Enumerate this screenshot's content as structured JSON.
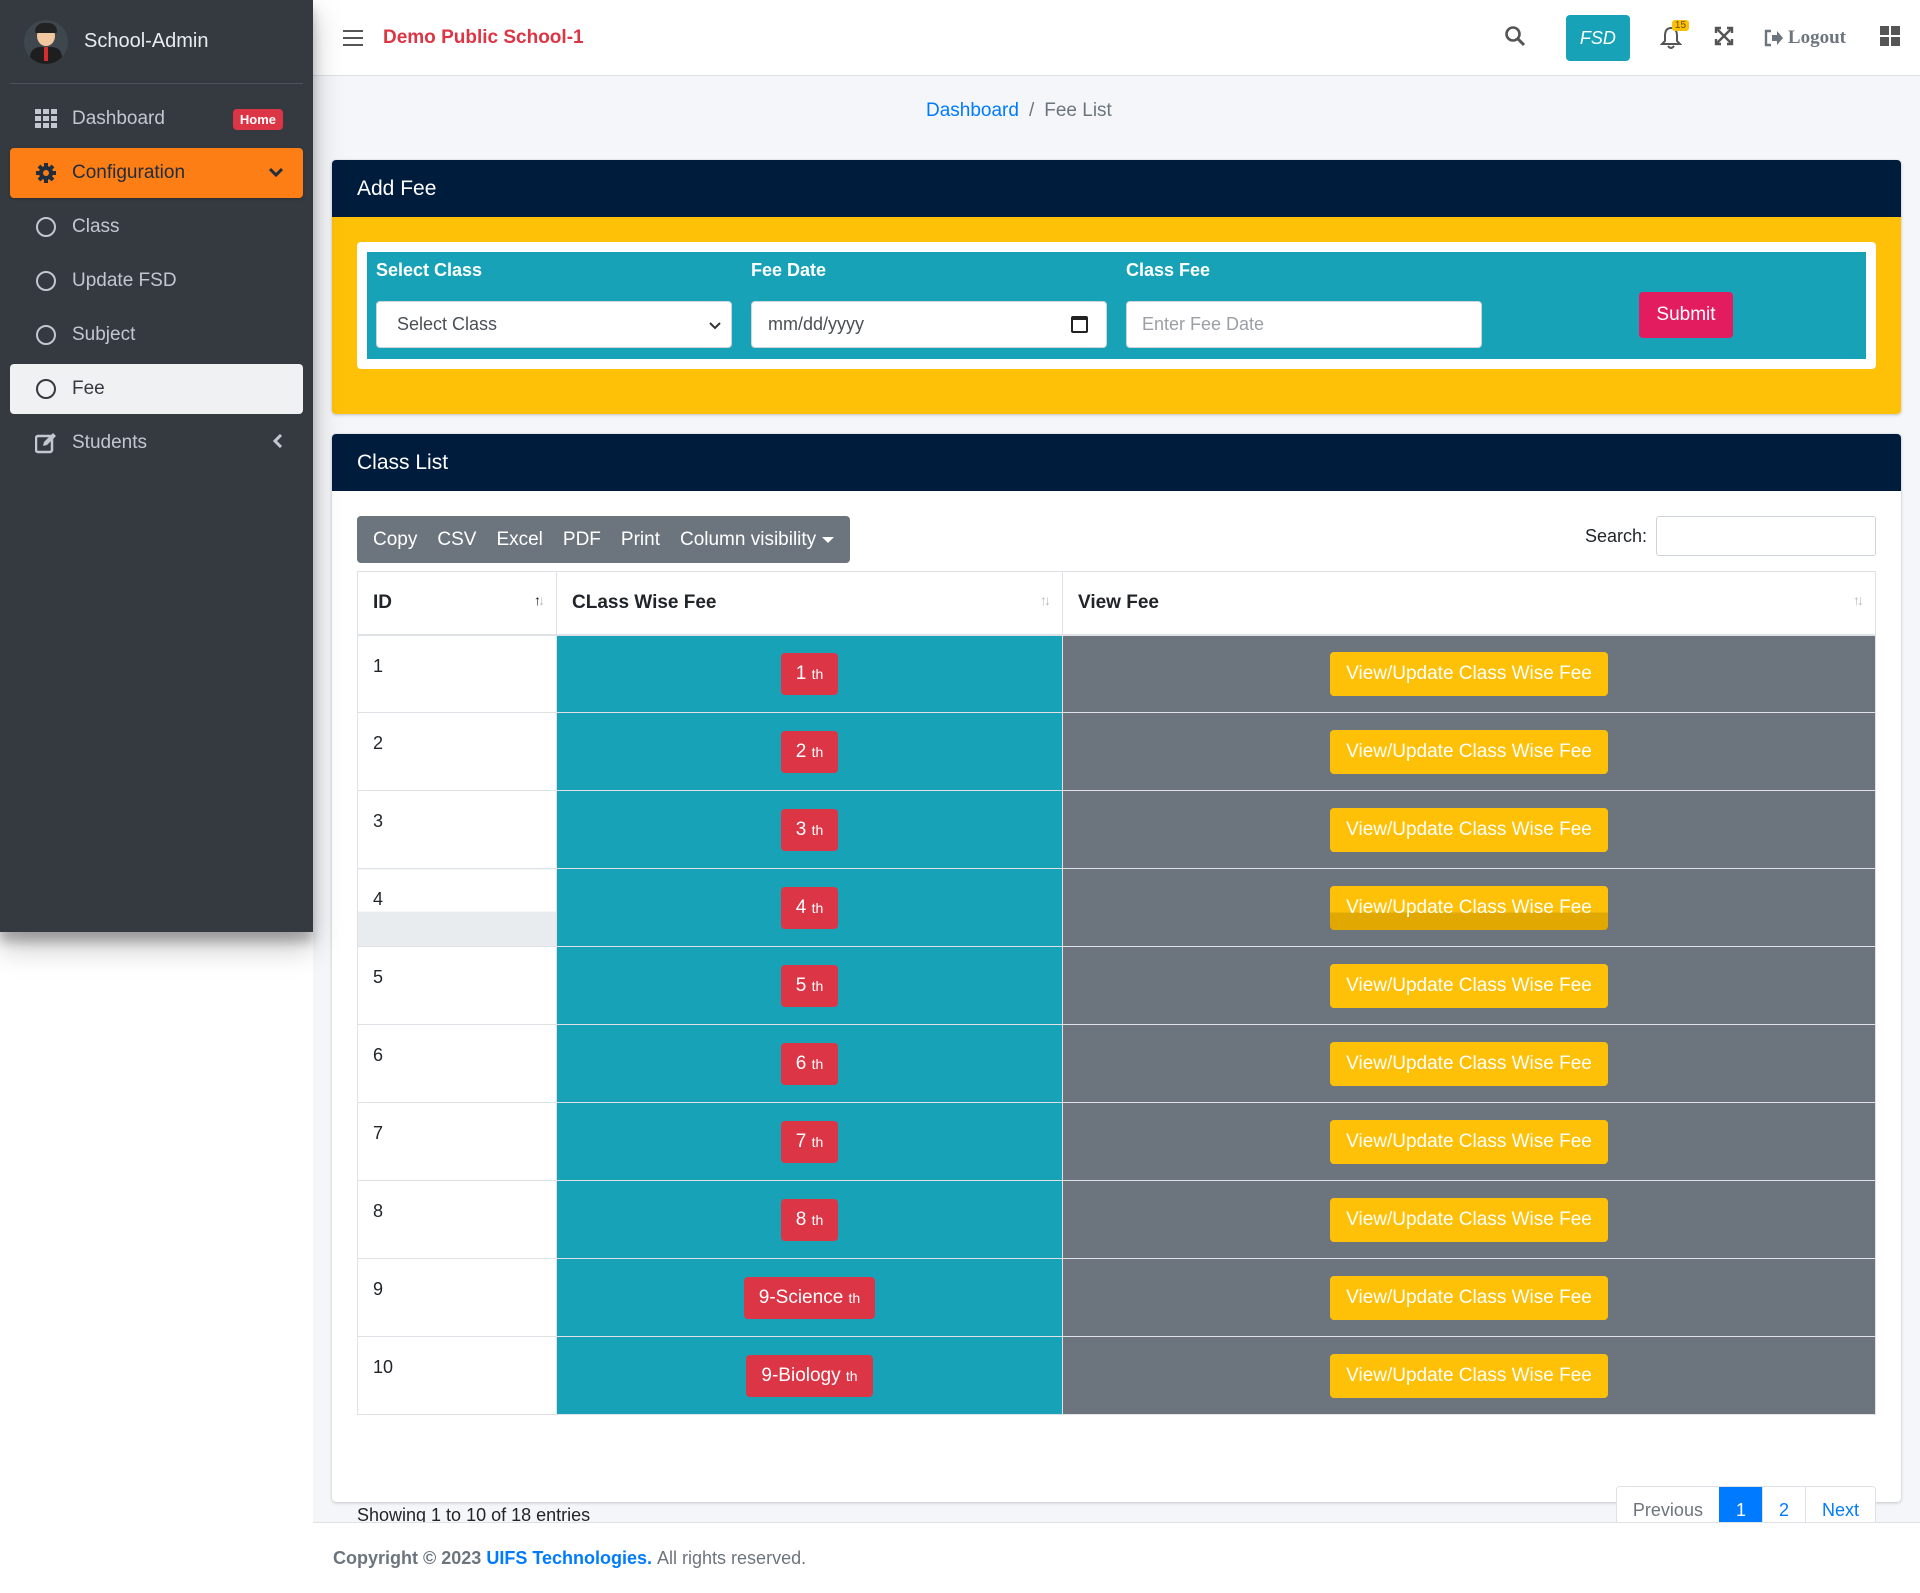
{
  "app": {
    "title": "School-Admin",
    "school_name": "Demo Public School-1"
  },
  "sidebar": {
    "items": [
      {
        "label": "Dashboard",
        "badge": "Home",
        "icon": "grid-icon"
      },
      {
        "label": "Configuration",
        "icon": "gear-icon"
      },
      {
        "label": "Class",
        "icon": "circle-icon"
      },
      {
        "label": "Update FSD",
        "icon": "circle-icon"
      },
      {
        "label": "Subject",
        "icon": "circle-icon"
      },
      {
        "label": "Fee",
        "icon": "circle-icon"
      },
      {
        "label": "Students",
        "icon": "edit-icon"
      }
    ]
  },
  "topbar": {
    "fsd_label": "FSD",
    "notification_count": "15",
    "logout_label": "Logout"
  },
  "breadcrumb": {
    "home": "Dashboard",
    "current": "Fee List"
  },
  "add_fee": {
    "title": "Add Fee",
    "select_class_label": "Select Class",
    "select_class_value": "Select Class",
    "fee_date_label": "Fee Date",
    "fee_date_placeholder": "mm/dd/yyyy",
    "class_fee_label": "Class Fee",
    "class_fee_placeholder": "Enter Fee Date",
    "submit_label": "Submit"
  },
  "class_list": {
    "title": "Class List",
    "buttons": [
      "Copy",
      "CSV",
      "Excel",
      "PDF",
      "Print",
      "Column visibility"
    ],
    "search_label": "Search:",
    "columns": [
      "ID",
      "CLass Wise Fee",
      "View Fee"
    ],
    "rows": [
      {
        "id": "1",
        "cls": "1",
        "suffix": "th",
        "action": "View/Update Class Wise Fee"
      },
      {
        "id": "2",
        "cls": "2",
        "suffix": "th",
        "action": "View/Update Class Wise Fee"
      },
      {
        "id": "3",
        "cls": "3",
        "suffix": "th",
        "action": "View/Update Class Wise Fee"
      },
      {
        "id": "4",
        "cls": "4",
        "suffix": "th",
        "action": "View/Update Class Wise Fee"
      },
      {
        "id": "5",
        "cls": "5",
        "suffix": "th",
        "action": "View/Update Class Wise Fee"
      },
      {
        "id": "6",
        "cls": "6",
        "suffix": "th",
        "action": "View/Update Class Wise Fee"
      },
      {
        "id": "7",
        "cls": "7",
        "suffix": "th",
        "action": "View/Update Class Wise Fee"
      },
      {
        "id": "8",
        "cls": "8",
        "suffix": "th",
        "action": "View/Update Class Wise Fee"
      },
      {
        "id": "9",
        "cls": "9-Science",
        "suffix": "th",
        "action": "View/Update Class Wise Fee"
      },
      {
        "id": "10",
        "cls": "9-Biology",
        "suffix": "th",
        "action": "View/Update Class Wise Fee"
      }
    ],
    "showing": "Showing 1 to 10 of 18 entries",
    "pagination": {
      "previous": "Previous",
      "pages": [
        "1",
        "2"
      ],
      "next": "Next"
    }
  },
  "footer": {
    "prefix": "Copyright © 2023",
    "company": "UIFS Technologies.",
    "suffix": "All rights reserved."
  },
  "colors": {
    "accent": "#fd7e14",
    "header": "#001c3d",
    "teal": "#17a2b8",
    "warning": "#ffc107",
    "danger": "#dc3545"
  }
}
